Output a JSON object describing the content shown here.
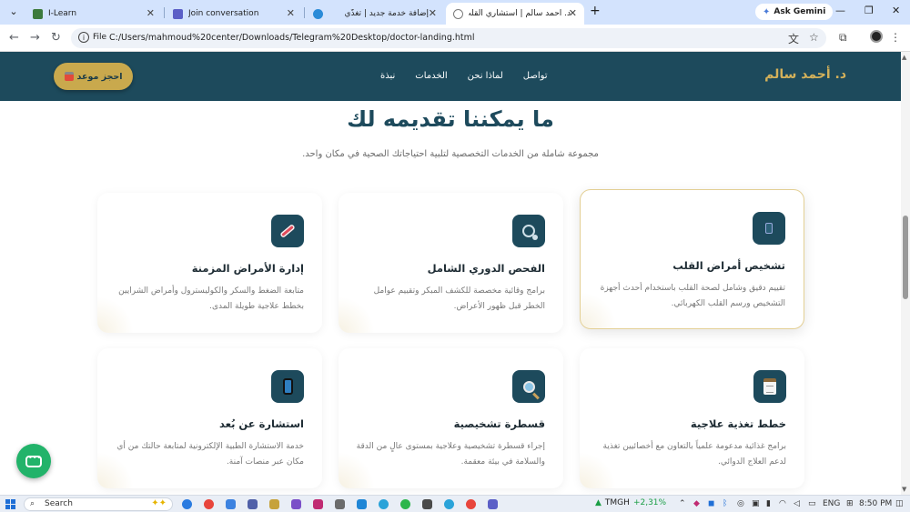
{
  "browser": {
    "tabs": [
      {
        "label": "I-Learn",
        "icon_color": "#3c7a3c",
        "active": false
      },
      {
        "label": "Join conversation",
        "icon_color": "#5b5fc7",
        "active": false
      },
      {
        "label": "إضافة خدمة جديد | تغذّي",
        "icon_color": "#2a8bd8",
        "active": false
      },
      {
        "label": "د. أحمد سالم | استشاري القلب والأ",
        "icon_color": "#7a7a7a",
        "active": true
      }
    ],
    "ask_gemini": "Ask Gemini",
    "address": {
      "protocol_label": "File",
      "url": "C:/Users/mahmoud%20center/Downloads/Telegram%20Desktop/doctor-landing.html"
    }
  },
  "site": {
    "brand": "د. أحمد سالم",
    "nav": [
      "نبذة",
      "الخدمات",
      "لماذا نحن",
      "تواصل"
    ],
    "cta_label": "احجز موعد",
    "colors": {
      "primary": "#1d4a5c",
      "accent": "#c9a94d",
      "brand_text": "#d4b15a"
    }
  },
  "services": {
    "title": "ما يمكننا تقديمه لك",
    "subtitle": "مجموعة شاملة من الخدمات التخصصية لتلبية احتياجاتك الصحية في مكان واحد.",
    "cards": [
      {
        "icon": "phone-icon",
        "title": "تشخيص أمراض القلب",
        "desc": "تقييم دقيق وشامل لصحة القلب باستخدام أحدث أجهزة التشخيص ورسم القلب الكهربائي.",
        "highlighted": true
      },
      {
        "icon": "stethoscope-icon",
        "title": "الفحص الدوري الشامل",
        "desc": "برامج وقائية مخصصة للكشف المبكر وتقييم عوامل الخطر قبل ظهور الأعراض.",
        "highlighted": false
      },
      {
        "icon": "syringe-icon",
        "title": "إدارة الأمراض المزمنة",
        "desc": "متابعة الضغط والسكر والكوليسترول وأمراض الشرايين بخطط علاجية طويلة المدى.",
        "highlighted": false
      },
      {
        "icon": "clipboard-icon",
        "title": "خطط تغذية علاجية",
        "desc": "برامج غذائية مدعومة علمياً بالتعاون مع أخصائيين تغذية لدعم العلاج الدوائي.",
        "highlighted": false
      },
      {
        "icon": "magnifier-icon",
        "title": "قسطرة تشخيصية",
        "desc": "إجراء قسطرة تشخيصية وعلاجية بمستوى عالٍ من الدقة والسلامة في بيئة معقمة.",
        "highlighted": false
      },
      {
        "icon": "mobile-icon",
        "title": "استشارة عن بُعد",
        "desc": "خدمة الاستشارة الطبية الإلكترونية لمتابعة حالتك من أي مكان عبر منصات آمنة.",
        "highlighted": false
      }
    ]
  },
  "taskbar": {
    "search_label": "Search",
    "stock_symbol": "TMGH",
    "stock_change": "+2,31%",
    "lang": "ENG",
    "time": "8:50 PM"
  }
}
